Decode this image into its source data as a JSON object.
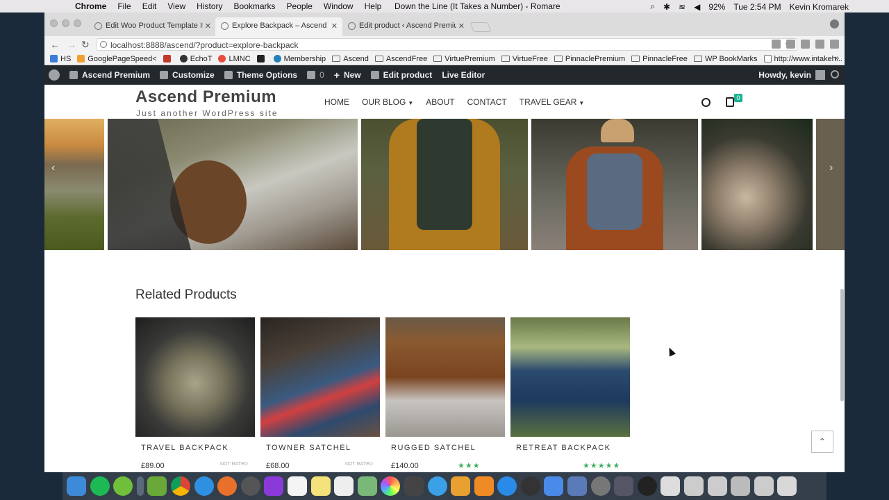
{
  "mac_menubar": {
    "app": "Chrome",
    "items": [
      "File",
      "Edit",
      "View",
      "History",
      "Bookmarks",
      "People",
      "Window",
      "Help"
    ],
    "now_playing": "Down the Line (It Takes a Number) - Romare",
    "battery": "92%",
    "clock": "Tue 2:54 PM",
    "user": "Kevin Kromarek"
  },
  "browser": {
    "tabs": [
      {
        "label": "Edit Woo Product Template Ite",
        "active": false
      },
      {
        "label": "Explore Backpack – Ascend Pr",
        "active": true
      },
      {
        "label": "Edit product ‹ Ascend Premiu",
        "active": false
      }
    ],
    "url": "localhost:8888/ascend/?product=explore-backpack",
    "bookmarks": [
      "HS",
      "GooglePageSpeed<",
      "",
      "EchoT",
      "LMNC",
      "",
      "Membership",
      "Ascend",
      "AscendFree",
      "VirtuePremium",
      "VirtueFree",
      "PinnaclePremium",
      "PinnacleFree",
      "WP BookMarks",
      "http://www.intakeh..."
    ],
    "bookmark_more": "»"
  },
  "wp_admin_bar": {
    "site_name": "Ascend Premium",
    "customize": "Customize",
    "theme_options": "Theme Options",
    "comments_count": "0",
    "new": "New",
    "edit_product": "Edit product",
    "live_editor": "Live Editor",
    "howdy": "Howdy, kevin"
  },
  "site": {
    "title": "Ascend Premium",
    "tagline": "Just another WordPress site",
    "nav": [
      {
        "label": "HOME",
        "dropdown": false
      },
      {
        "label": "OUR BLOG",
        "dropdown": true
      },
      {
        "label": "ABOUT",
        "dropdown": false
      },
      {
        "label": "CONTACT",
        "dropdown": false
      },
      {
        "label": "TRAVEL GEAR",
        "dropdown": true
      }
    ],
    "cart_count": "0"
  },
  "carousel": {
    "prev": "‹",
    "next": "›",
    "slides": [
      "mountain sunset",
      "girl hand out car window",
      "hiker yellow jacket backpack",
      "hiker beanie backpack",
      "stacked firewood logs",
      "partial slide"
    ]
  },
  "related": {
    "title": "Related Products",
    "products": [
      {
        "name": "TRAVEL BACKPACK",
        "price": "£89.00",
        "rating_text": "NOT RATED",
        "stars": ""
      },
      {
        "name": "TOWNER SATCHEL",
        "price": "£68.00",
        "rating_text": "NOT RATED",
        "stars": ""
      },
      {
        "name": "RUGGED SATCHEL",
        "price": "£140.00",
        "rating_text": "",
        "stars": "★★★"
      },
      {
        "name": "RETREAT BACKPACK",
        "price": "",
        "rating_text": "",
        "stars": "★★★★★"
      }
    ]
  },
  "scroll_top": "⌃"
}
